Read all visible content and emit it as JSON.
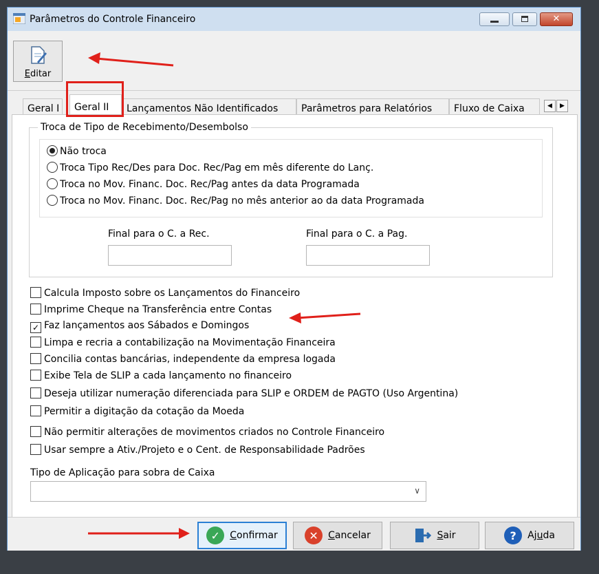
{
  "window": {
    "title": "Parâmetros do Controle Financeiro"
  },
  "toolbar": {
    "editar_label": "Editar",
    "editar_underline": "E",
    "editar_rest": "ditar"
  },
  "tabs": [
    {
      "label": "Geral I"
    },
    {
      "label": "Geral II",
      "active": true
    },
    {
      "label": "Lançamentos Não Identificados"
    },
    {
      "label": "Parâmetros para Relatórios"
    },
    {
      "label": "Fluxo de Caixa"
    }
  ],
  "tab_scroll": {
    "left": "◀",
    "right": "▶"
  },
  "group": {
    "title": "Troca de Tipo de Recebimento/Desembolso",
    "radios": [
      {
        "label": "Não troca",
        "selected": true
      },
      {
        "label": "Troca Tipo Rec/Des para Doc. Rec/Pag em mês diferente do Lanç.",
        "selected": false
      },
      {
        "label": "Troca no Mov. Financ. Doc. Rec/Pag antes da data Programada",
        "selected": false
      },
      {
        "label": "Troca no Mov. Financ. Doc. Rec/Pag no mês anterior ao da data Programada",
        "selected": false
      }
    ],
    "final_rec_label": "Final para o C. a Rec.",
    "final_rec_value": "",
    "final_pag_label": "Final para o C. a Pag.",
    "final_pag_value": ""
  },
  "checkboxes": [
    {
      "label": "Calcula Imposto sobre os Lançamentos do Financeiro",
      "checked": false
    },
    {
      "label": "Imprime Cheque na Transferência entre Contas",
      "checked": false
    },
    {
      "label": "Faz lançamentos aos Sábados e Domingos",
      "checked": true
    },
    {
      "label": "Limpa e recria a contabilização na Movimentação Financeira",
      "checked": false
    },
    {
      "label": "Concilia contas bancárias, independente da empresa logada",
      "checked": false
    },
    {
      "label": "Exibe Tela de SLIP a cada lançamento no financeiro",
      "checked": false
    },
    {
      "label": "Deseja utilizar numeração diferenciada para SLIP e ORDEM de PAGTO (Uso Argentina)",
      "checked": false
    },
    {
      "label": "Permitir a digitação da cotação da Moeda",
      "checked": false
    },
    {
      "label": "Não permitir alterações de movimentos criados no Controle Financeiro",
      "checked": false
    },
    {
      "label": "Usar sempre a Ativ./Projeto e o Cent. de Responsabilidade Padrões",
      "checked": false
    }
  ],
  "combo": {
    "label": "Tipo de Aplicação para sobra de Caixa",
    "value": ""
  },
  "buttons": {
    "confirmar": {
      "pre": "",
      "ul": "C",
      "post": "onfirmar",
      "color": "#3aa757"
    },
    "cancelar": {
      "pre": "",
      "ul": "C",
      "post": "ancelar",
      "color": "#d9412b"
    },
    "sair": {
      "pre": "",
      "ul": "S",
      "post": "air",
      "color": "#2b6cb0"
    },
    "ajuda": {
      "pre": "Aj",
      "ul": "u",
      "post": "da",
      "color": "#1f5fb8"
    }
  },
  "colors": {
    "annotation": "#e0201a",
    "accent": "#2a7fd4"
  }
}
